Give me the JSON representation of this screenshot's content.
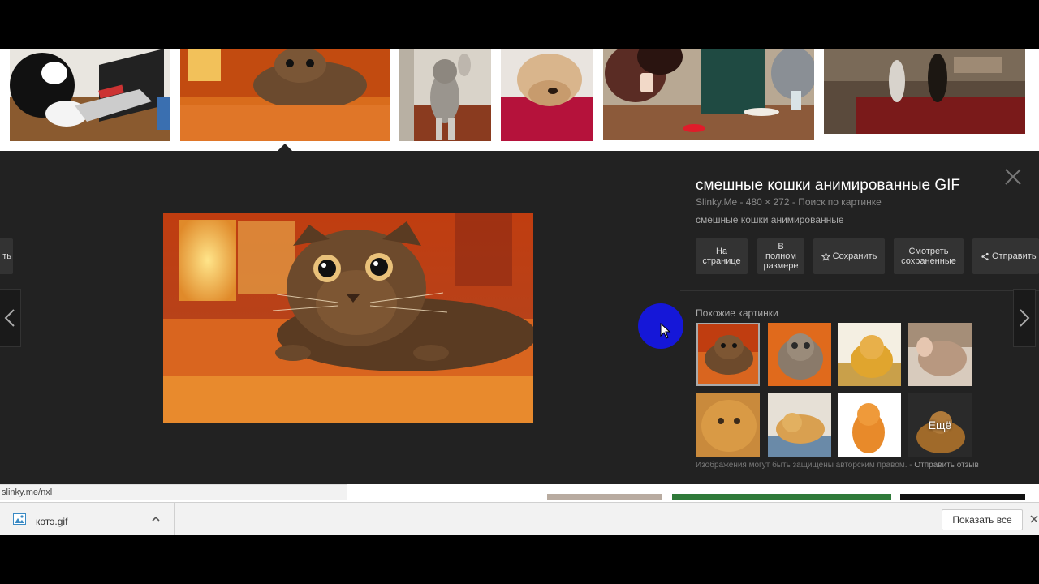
{
  "detail": {
    "title": "смешные кошки анимированные GIF",
    "source": "Slinky.Me",
    "dimensions": "480 × 272",
    "search_by_image": "Поиск по картинке",
    "separator": " - ",
    "description": "смешные кошки анимированные",
    "left_partial_button": "ть",
    "actions": {
      "visit_line1": "На",
      "visit_line2": "странице",
      "full_line1": "В",
      "full_line2": "полном",
      "full_line3": "размере",
      "save": "Сохранить",
      "saved_line1": "Смотреть",
      "saved_line2": "сохраненные",
      "share": "Отправить"
    },
    "similar_label": "Похожие картинки",
    "more_label": "Ещё",
    "copyright_notice": "Изображения могут быть защищены авторским правом.",
    "copyright_sep": " - ",
    "feedback_link": "Отправить отзыв"
  },
  "status_url": "slinky.me/nxl",
  "downloads": {
    "file_name": "котэ.gif",
    "show_all": "Показать все"
  },
  "colors": {
    "panel_bg": "#222222",
    "cursor_highlight": "#1517d8",
    "download_bar": "#f2f2f2"
  },
  "icons": [
    "close-icon",
    "chevron-left-icon",
    "chevron-right-icon",
    "star-icon",
    "share-icon",
    "image-file-icon",
    "chevron-up-icon",
    "mouse-pointer-icon"
  ]
}
